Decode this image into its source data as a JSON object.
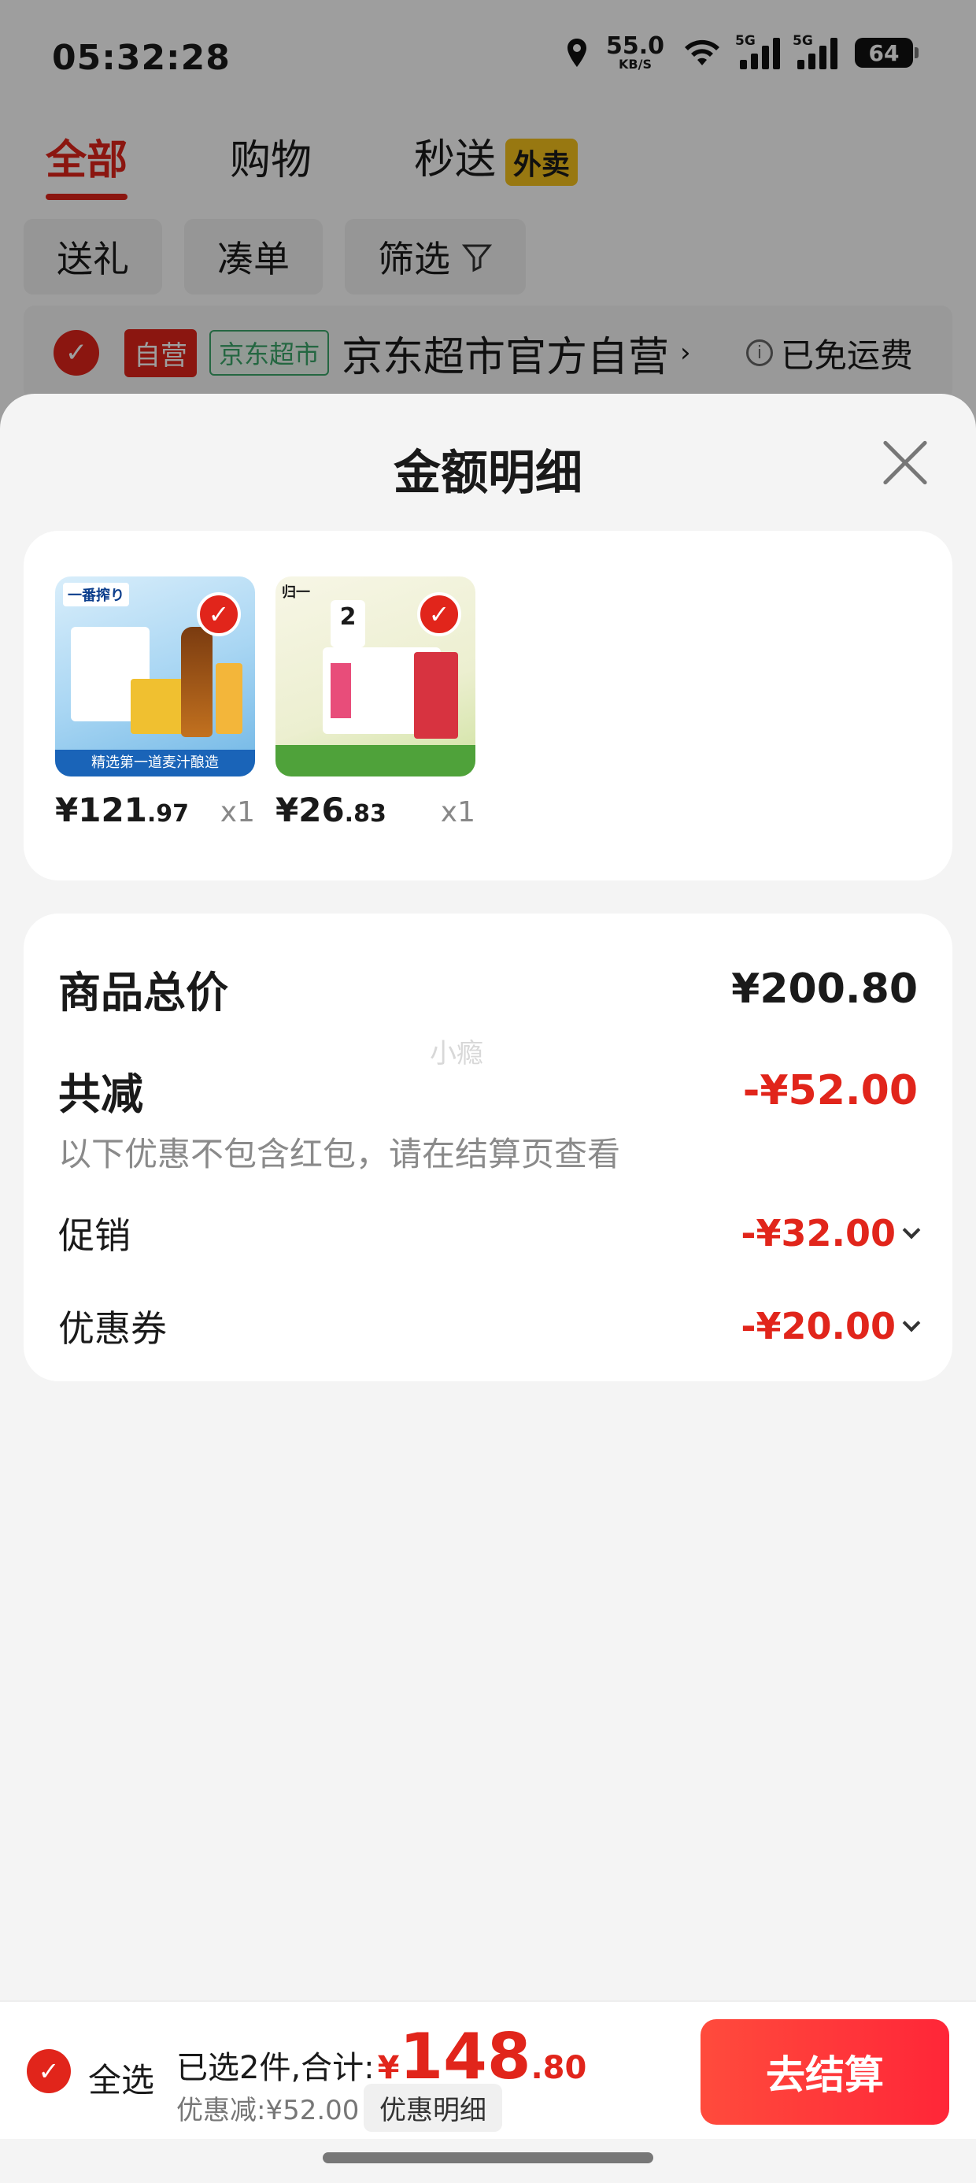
{
  "status": {
    "time": "05:32:28",
    "net_speed": "55.0",
    "net_unit": "KB/S",
    "signal1": "5G",
    "signal2": "5G",
    "battery": "64"
  },
  "tabs": [
    {
      "label": "全部"
    },
    {
      "label": "购物"
    },
    {
      "label": "秒送",
      "badge": "外卖"
    }
  ],
  "filters": [
    "送礼",
    "凑单",
    "筛选"
  ],
  "shop": {
    "tag_self": "自营",
    "tag_market": "京东超市",
    "name": "京东超市官方自营",
    "arrow": "›",
    "shipping": "已免运费"
  },
  "sheet": {
    "title": "金额明细",
    "products": [
      {
        "price_int": "¥121",
        "price_dec": ".97",
        "qty": "x1",
        "img_brand": "一番搾り",
        "img_caption": "精选第一道麦汁酿造"
      },
      {
        "price_int": "¥26",
        "price_dec": ".83",
        "qty": "x1",
        "img_brand": "归一",
        "img_age": "2"
      }
    ],
    "summary": {
      "total_label": "商品总价",
      "total_value": "¥200.80",
      "discount_label": "共减",
      "discount_value": "-¥52.00",
      "note": "以下优惠不包含红包，请在结算页查看",
      "promo_label": "促销",
      "promo_value": "-¥32.00",
      "coupon_label": "优惠券",
      "coupon_value": "-¥20.00",
      "watermark": "小瘾"
    }
  },
  "bottom": {
    "select_all": "全选",
    "selected_text": "已选2件,合计:",
    "currency": "¥",
    "amount_int": "148",
    "amount_dec": ".80",
    "saved": "优惠减:¥52.00",
    "detail_button": "优惠明细",
    "checkout": "去结算"
  },
  "colors": {
    "accent": "#e1251b",
    "badge_yellow": "#f6c21c"
  }
}
